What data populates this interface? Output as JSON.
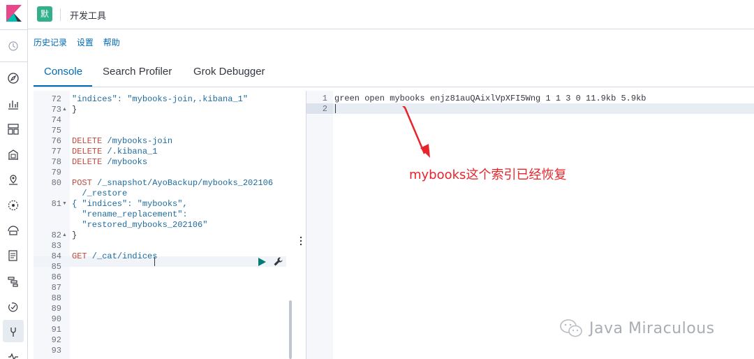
{
  "header": {
    "space_initial": "默",
    "title": "开发工具"
  },
  "top_links": [
    "历史记录",
    "设置",
    "帮助"
  ],
  "tabs": [
    "Console",
    "Search Profiler",
    "Grok Debugger"
  ],
  "active_tab": "Console",
  "nav_icons": [
    "recent-icon",
    "discover-icon",
    "visualize-icon",
    "dashboard-icon",
    "canvas-icon",
    "maps-icon",
    "ml-icon",
    "infrastructure-icon",
    "logs-icon",
    "apm-icon",
    "uptime-icon",
    "devtools-icon",
    "monitoring-icon"
  ],
  "editor": {
    "lines": [
      {
        "num": "72",
        "fold": "",
        "text": "\"indices\": \"mybooks-join,.kibana_1\"",
        "style": "str"
      },
      {
        "num": "73",
        "fold": "▲",
        "text": "}",
        "style": "plain"
      },
      {
        "num": "74",
        "fold": "",
        "text": "",
        "style": "plain"
      },
      {
        "num": "75",
        "fold": "",
        "text": "",
        "style": "plain"
      },
      {
        "num": "76",
        "fold": "",
        "text": "DELETE /mybooks-join",
        "style": "req"
      },
      {
        "num": "77",
        "fold": "",
        "text": "DELETE /.kibana_1",
        "style": "req"
      },
      {
        "num": "78",
        "fold": "",
        "text": "DELETE /mybooks",
        "style": "req"
      },
      {
        "num": "79",
        "fold": "",
        "text": "",
        "style": "plain"
      },
      {
        "num": "80",
        "fold": "",
        "text": "POST /_snapshot/AyoBackup/mybooks_202106",
        "style": "req"
      },
      {
        "num": "",
        "fold": "",
        "text": "  /_restore",
        "style": "url"
      },
      {
        "num": "81",
        "fold": "▼",
        "text": "{ \"indices\": \"mybooks\",",
        "style": "str"
      },
      {
        "num": "",
        "fold": "",
        "text": "  \"rename_replacement\":",
        "style": "str"
      },
      {
        "num": "",
        "fold": "",
        "text": "  \"restored_mybooks_202106\"",
        "style": "str"
      },
      {
        "num": "82",
        "fold": "▲",
        "text": "}",
        "style": "plain"
      },
      {
        "num": "83",
        "fold": "",
        "text": "",
        "style": "plain"
      },
      {
        "num": "84",
        "fold": "",
        "text": "GET /_cat/indices",
        "style": "req"
      },
      {
        "num": "85",
        "fold": "",
        "text": "",
        "style": "plain"
      },
      {
        "num": "86",
        "fold": "",
        "text": "",
        "style": "plain"
      },
      {
        "num": "87",
        "fold": "",
        "text": "",
        "style": "plain"
      },
      {
        "num": "88",
        "fold": "",
        "text": "",
        "style": "plain"
      },
      {
        "num": "89",
        "fold": "",
        "text": "",
        "style": "plain"
      },
      {
        "num": "90",
        "fold": "",
        "text": "",
        "style": "plain"
      },
      {
        "num": "91",
        "fold": "",
        "text": "",
        "style": "plain"
      },
      {
        "num": "92",
        "fold": "",
        "text": "",
        "style": "plain"
      },
      {
        "num": "93",
        "fold": "",
        "text": "",
        "style": "plain"
      }
    ]
  },
  "output": {
    "lines": [
      {
        "num": "1",
        "text": "green open mybooks enjz81auQAixlVpXFI5Wng 1 1 3 0 11.9kb 5.9kb"
      },
      {
        "num": "2",
        "text": ""
      }
    ]
  },
  "annotation": {
    "text": "mybooks这个索引已经恢复",
    "color": "#e8242b"
  },
  "watermark": "Java Miraculous",
  "colors": {
    "accent": "#006bb4",
    "space_badge": "#31b08b",
    "method": "#c14a3e",
    "run_button": "#017d73"
  }
}
